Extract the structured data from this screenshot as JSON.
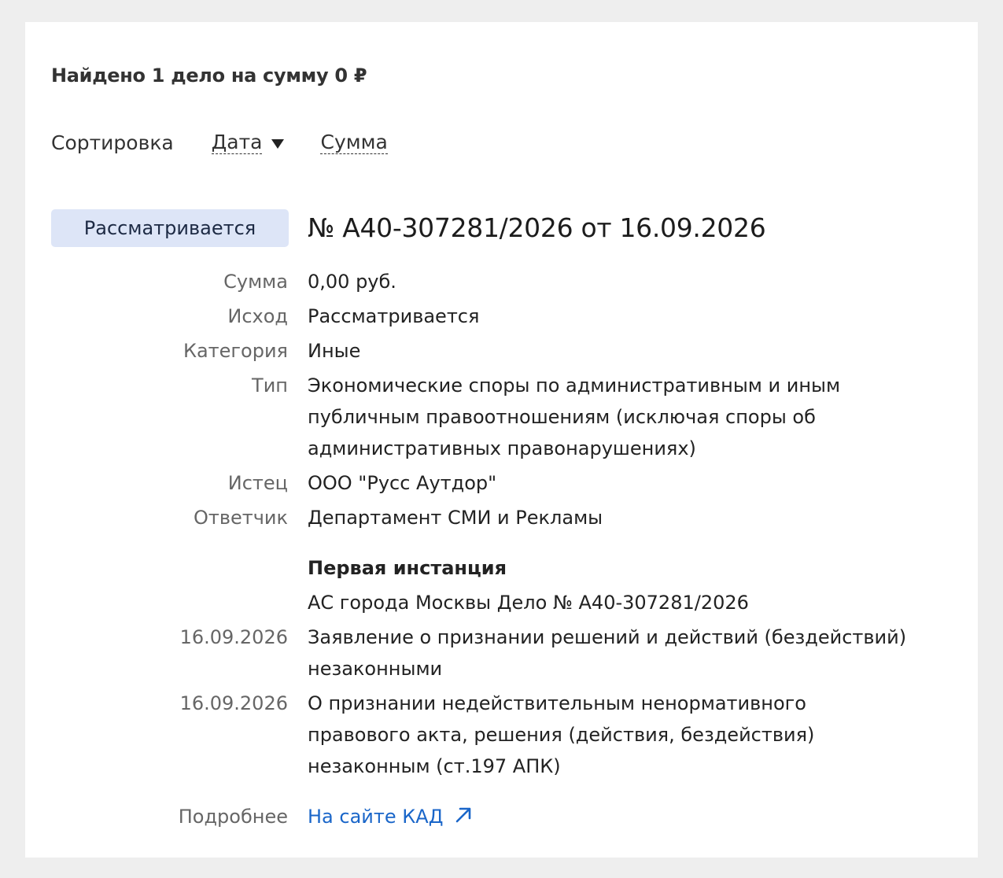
{
  "header": {
    "found_text": "Найдено 1 дело на сумму 0 ₽"
  },
  "sort": {
    "label": "Сортировка",
    "options": [
      {
        "label": "Дата",
        "active": true,
        "direction": "desc"
      },
      {
        "label": "Сумма",
        "active": false
      }
    ]
  },
  "case": {
    "status": "Рассматривается",
    "title": "№ А40-307281/2026 от 16.09.2026",
    "status_color": "#dde5f7",
    "link_color": "#1a66c9",
    "fields": {
      "sum": {
        "label": "Сумма",
        "value": "0,00 руб."
      },
      "outcome": {
        "label": "Исход",
        "value": "Рассматривается"
      },
      "category": {
        "label": "Категория",
        "value": "Иные"
      },
      "type": {
        "label": "Тип",
        "lines": [
          "Экономические споры по административным и иным",
          "публичным правоотношениям (исключая споры об",
          "административных правонарушениях)"
        ]
      },
      "plaintiff": {
        "label": "Истец",
        "value": "ООО \"Русс Аутдор\""
      },
      "defendant": {
        "label": "Ответчик",
        "value": "Департамент СМИ и Рекламы"
      }
    },
    "instance": {
      "heading": "Первая инстанция",
      "court": "АС города Москвы Дело № А40-307281/2026",
      "events": [
        {
          "date": "16.09.2026",
          "lines": [
            "Заявление о признании решений и действий (бездействий)",
            "незаконными"
          ]
        },
        {
          "date": "16.09.2026",
          "lines": [
            "О признании недействительным ненормативного",
            "правового акта, решения (действия, бездействия)",
            "незаконным (ст.197 АПК)"
          ]
        }
      ]
    },
    "more": {
      "label": "Подробнее",
      "link": "На сайте КАД",
      "icon": "external-link-arrow-icon"
    }
  }
}
